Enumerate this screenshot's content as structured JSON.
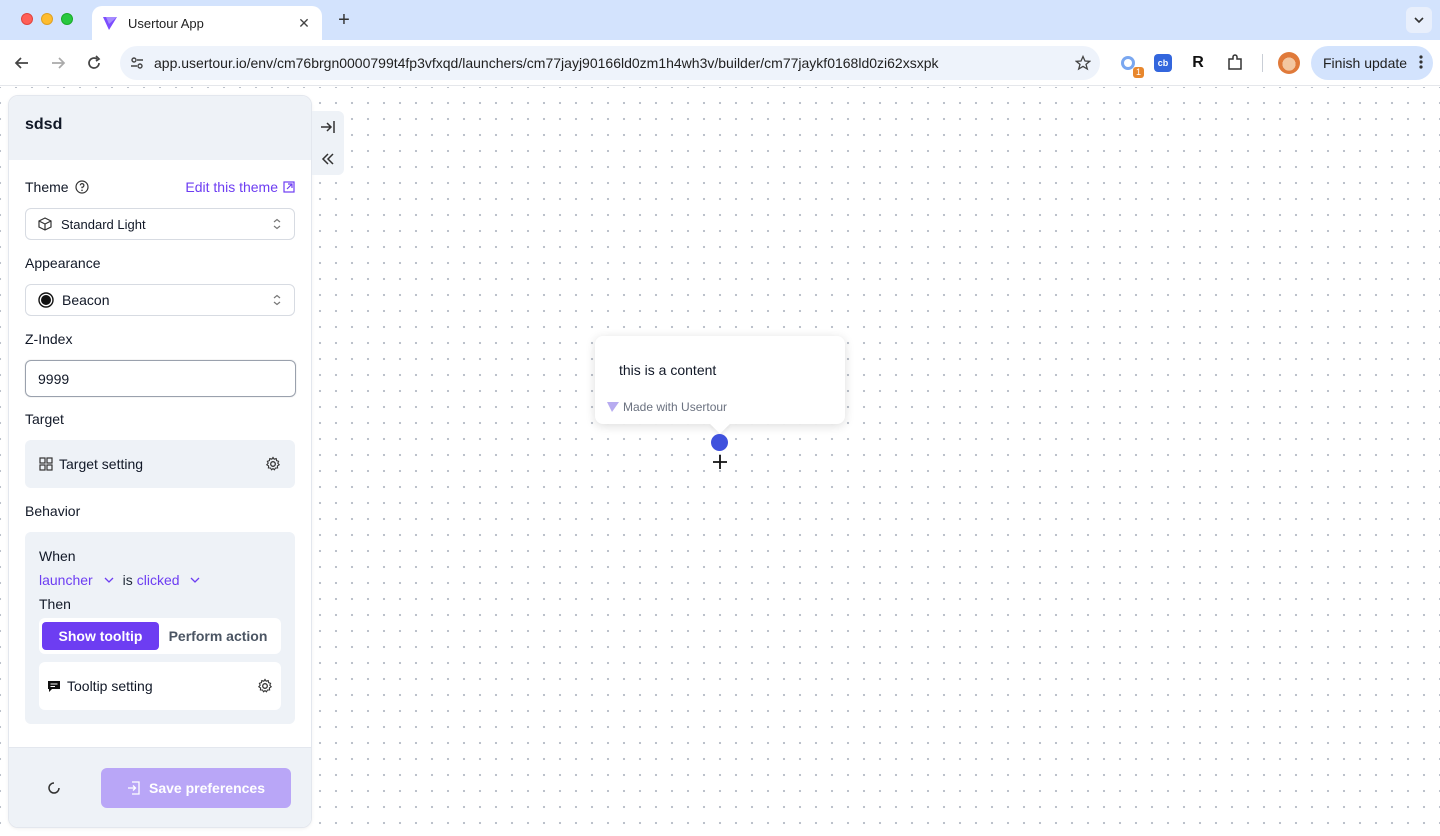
{
  "browser": {
    "tab_title": "Usertour App",
    "url": "app.usertour.io/env/cm76brgn0000799t4fp3vfxqd/launchers/cm77jayj90166ld0zm1h4wh3v/builder/cm77jaykf0168ld0zi62xsxpk",
    "extension_badge": "1",
    "extension_cb_label": "cb",
    "extension_r_label": "R",
    "finish_update_label": "Finish update"
  },
  "panel": {
    "title": "sdsd",
    "theme_label": "Theme",
    "edit_theme_label": "Edit this theme",
    "theme_value": "Standard Light",
    "appearance_label": "Appearance",
    "appearance_value": "Beacon",
    "zindex_label": "Z-Index",
    "zindex_value": "9999",
    "target_label": "Target",
    "target_setting_label": "Target setting",
    "behavior_label": "Behavior",
    "when_label": "When",
    "trigger_element": "launcher",
    "trigger_is": "is",
    "trigger_action": "clicked",
    "then_label": "Then",
    "show_tooltip_label": "Show tooltip",
    "perform_action_label": "Perform action",
    "tooltip_setting_label": "Tooltip setting",
    "save_label": "Save preferences"
  },
  "preview": {
    "content_text": "this is a content",
    "brand_text": "Made with Usertour"
  },
  "colors": {
    "accent": "#6d3df2",
    "beacon": "#3f51dd",
    "save_disabled": "#b9a6f7",
    "panel_bg": "#eef2f7"
  }
}
